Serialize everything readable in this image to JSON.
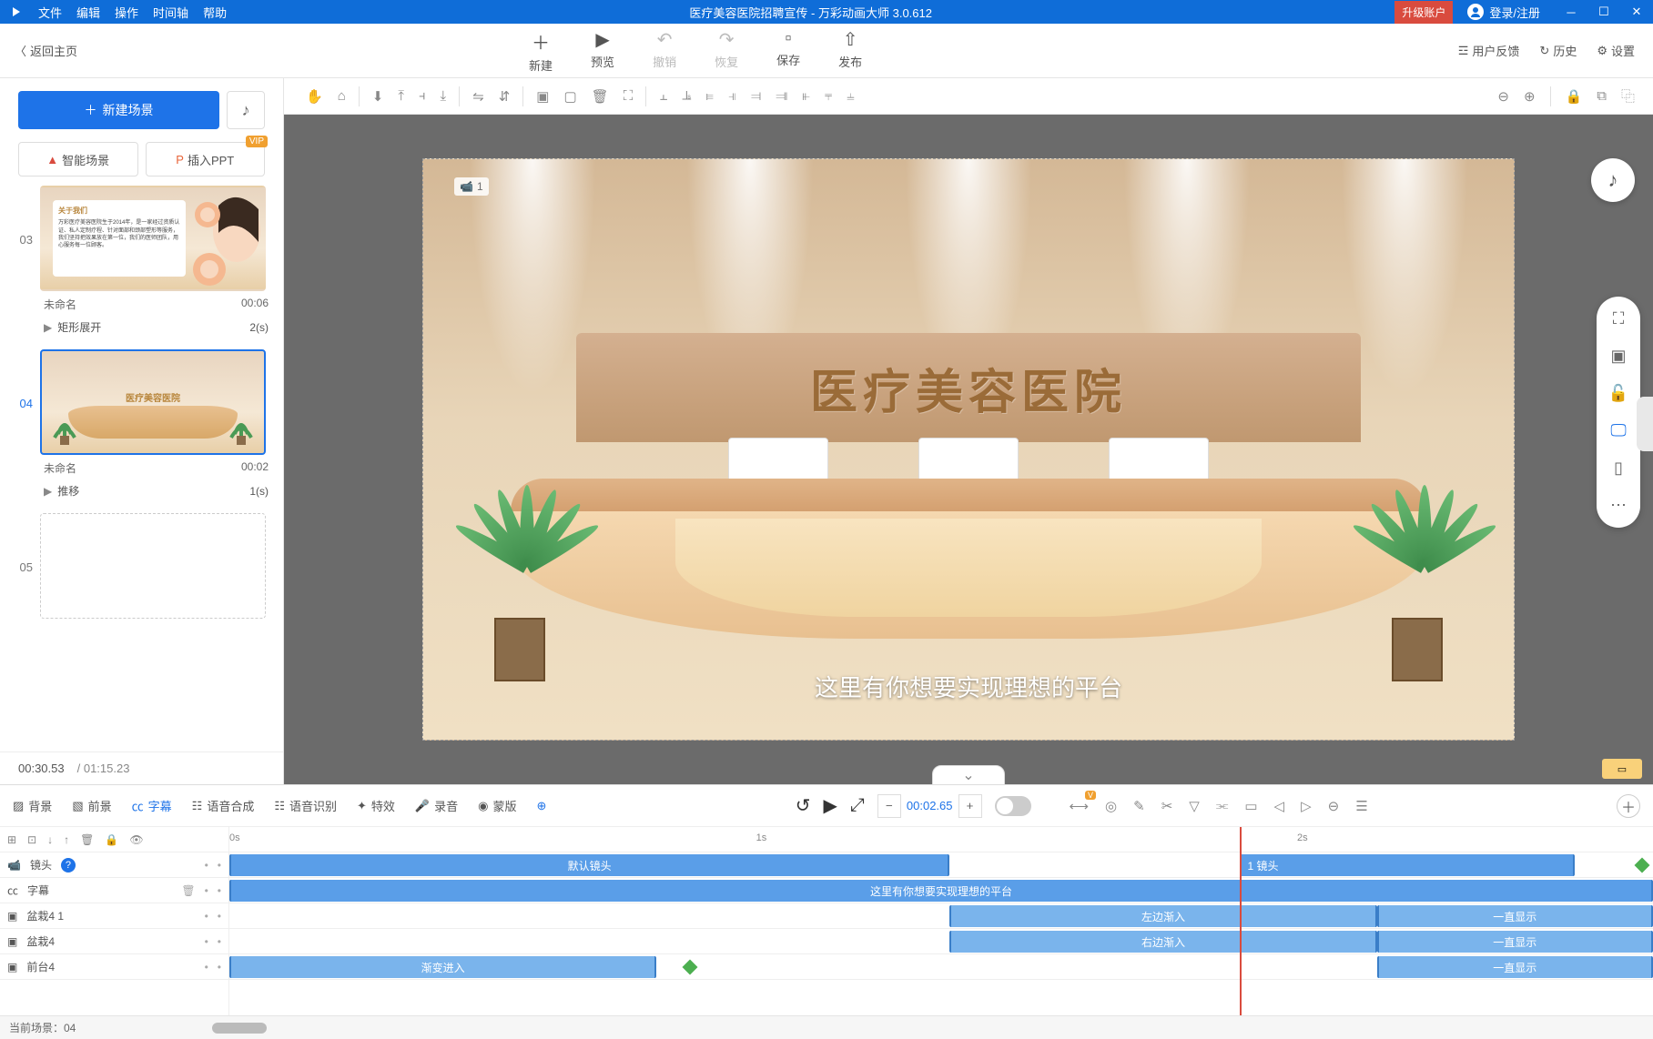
{
  "titlebar": {
    "menu": {
      "file": "文件",
      "edit": "编辑",
      "operate": "操作",
      "timeline": "时间轴",
      "help": "帮助"
    },
    "project": "医疗美容医院招聘宣传",
    "app": "万彩动画大师 3.0.612",
    "upgrade": "升级账户",
    "login": "登录/注册"
  },
  "toolbar": {
    "back": "返回主页",
    "new": "新建",
    "preview": "预览",
    "undo": "撤销",
    "redo": "恢复",
    "save": "保存",
    "publish": "发布",
    "feedback": "用户反馈",
    "history": "历史",
    "settings": "设置"
  },
  "leftpanel": {
    "newScene": "新建场景",
    "smartScene": "智能场景",
    "insertPPT": "插入PPT",
    "vip": "VIP",
    "scenes": [
      {
        "num": "03",
        "name": "未命名",
        "duration": "00:06",
        "transition": "矩形展开",
        "transDur": "2(s)"
      },
      {
        "num": "04",
        "name": "未命名",
        "duration": "00:02",
        "transition": "推移",
        "transDur": "1(s)"
      },
      {
        "num": "05",
        "name": "",
        "duration": "",
        "transition": "",
        "transDur": ""
      }
    ],
    "currentTime": "00:30.53",
    "totalTime": "/ 01:15.23"
  },
  "canvas": {
    "wallText": "医疗美容医院",
    "subtitle": "这里有你想要实现理想的平台",
    "cameraNum": "1"
  },
  "timeline": {
    "tabs": {
      "bg": "背景",
      "fg": "前景",
      "subtitle": "字幕",
      "tts": "语音合成",
      "asr": "语音识别",
      "fx": "特效",
      "record": "录音",
      "mask": "蒙版"
    },
    "time": "00:02.65",
    "ruler": {
      "t0": "0s",
      "t1": "1s",
      "t2": "2s"
    },
    "tracks": {
      "camera": "镜头",
      "subtitle": "字幕",
      "bonsai41": "盆栽4 1",
      "bonsai4": "盆栽4",
      "front4": "前台4"
    },
    "clips": {
      "defaultCam": "默认镜头",
      "cam1": "1 镜头",
      "sub": "这里有你想要实现理想的平台",
      "leftIn": "左边渐入",
      "rightIn": "右边渐入",
      "always": "一直显示",
      "fadeIn": "渐变进入"
    },
    "footer": {
      "current": "当前场景：04"
    }
  }
}
